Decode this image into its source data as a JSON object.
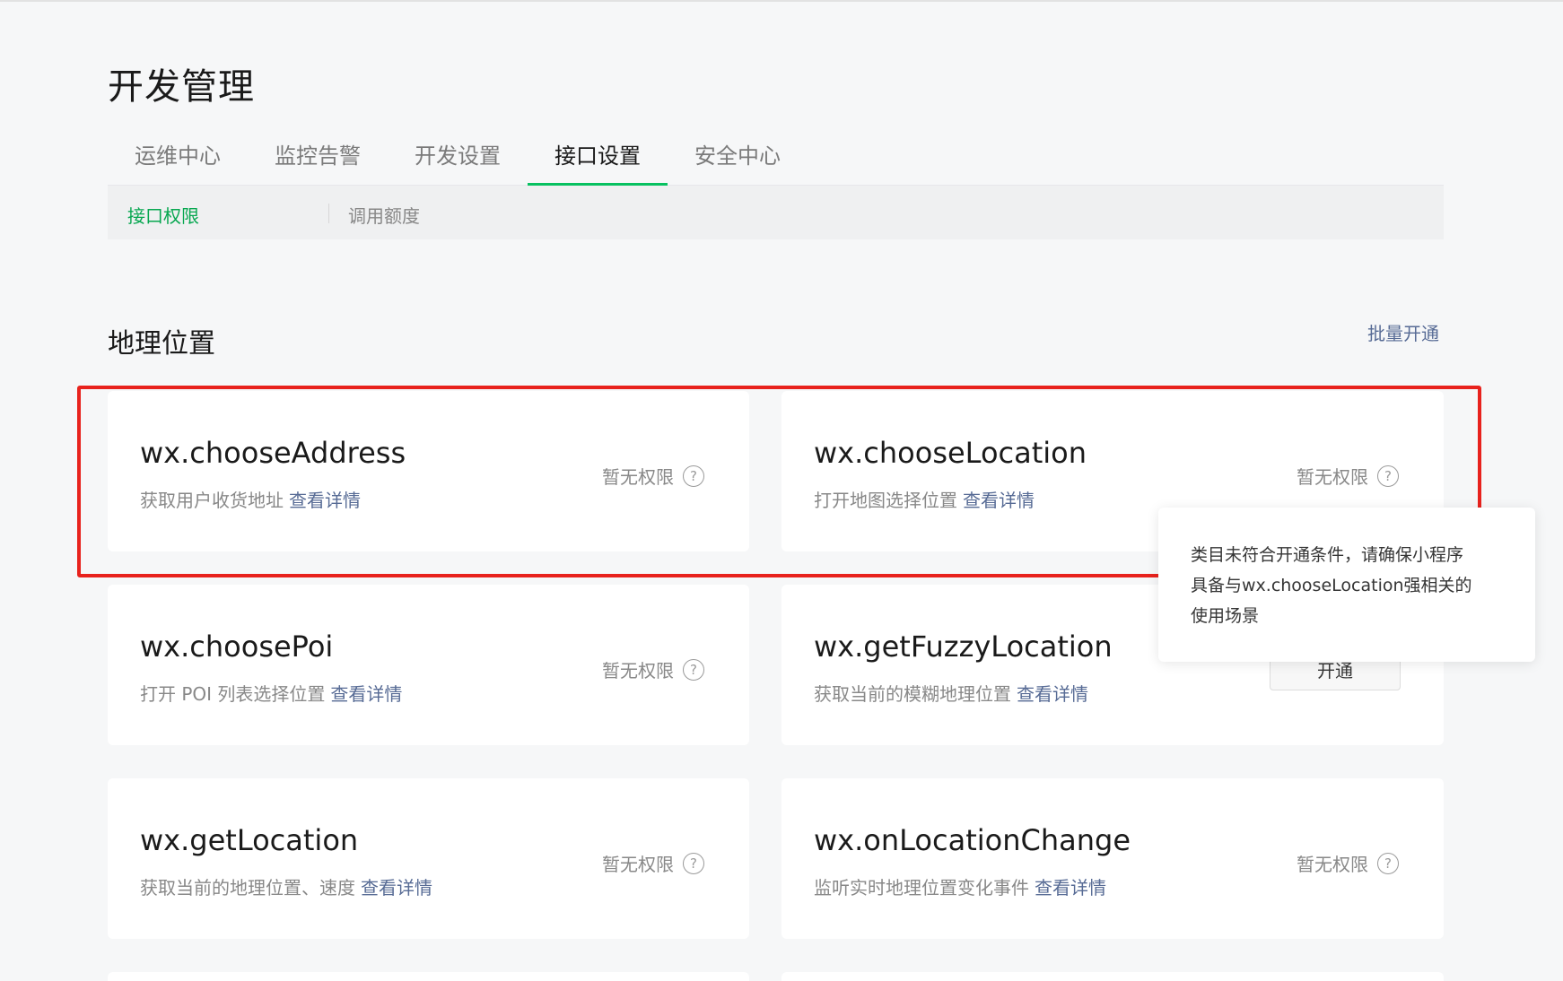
{
  "page": {
    "title": "开发管理"
  },
  "tabs": [
    {
      "label": "运维中心",
      "active": false
    },
    {
      "label": "监控告警",
      "active": false
    },
    {
      "label": "开发设置",
      "active": false
    },
    {
      "label": "接口设置",
      "active": true
    },
    {
      "label": "安全中心",
      "active": false
    }
  ],
  "subnav": [
    {
      "label": "接口权限",
      "active": true
    },
    {
      "label": "调用额度",
      "active": false
    }
  ],
  "section": {
    "title": "地理位置",
    "batch_action": "批量开通"
  },
  "cards": [
    {
      "name": "wx.chooseAddress",
      "description": "获取用户收货地址",
      "detail_link": "查看详情",
      "status": "暂无权限",
      "help": "?"
    },
    {
      "name": "wx.chooseLocation",
      "description": "打开地图选择位置",
      "detail_link": "查看详情",
      "status": "暂无权限",
      "help": "?"
    },
    {
      "name": "wx.choosePoi",
      "description": "打开 POI 列表选择位置",
      "detail_link": "查看详情",
      "status": "暂无权限",
      "help": "?"
    },
    {
      "name": "wx.getFuzzyLocation",
      "description": "获取当前的模糊地理位置",
      "detail_link": "查看详情",
      "button": "开通"
    },
    {
      "name": "wx.getLocation",
      "description": "获取当前的地理位置、速度",
      "detail_link": "查看详情",
      "status": "暂无权限",
      "help": "?"
    },
    {
      "name": "wx.onLocationChange",
      "description": "监听实时地理位置变化事件",
      "detail_link": "查看详情",
      "status": "暂无权限",
      "help": "?"
    }
  ],
  "tooltip": {
    "lines": [
      "类目未符合开通条件，请确保小程序",
      "具备与wx.chooseLocation强相关的",
      "使用场景"
    ]
  },
  "colors": {
    "accent_green": "#07c160",
    "link_blue": "#576b95",
    "highlight_red": "#e8221d"
  }
}
